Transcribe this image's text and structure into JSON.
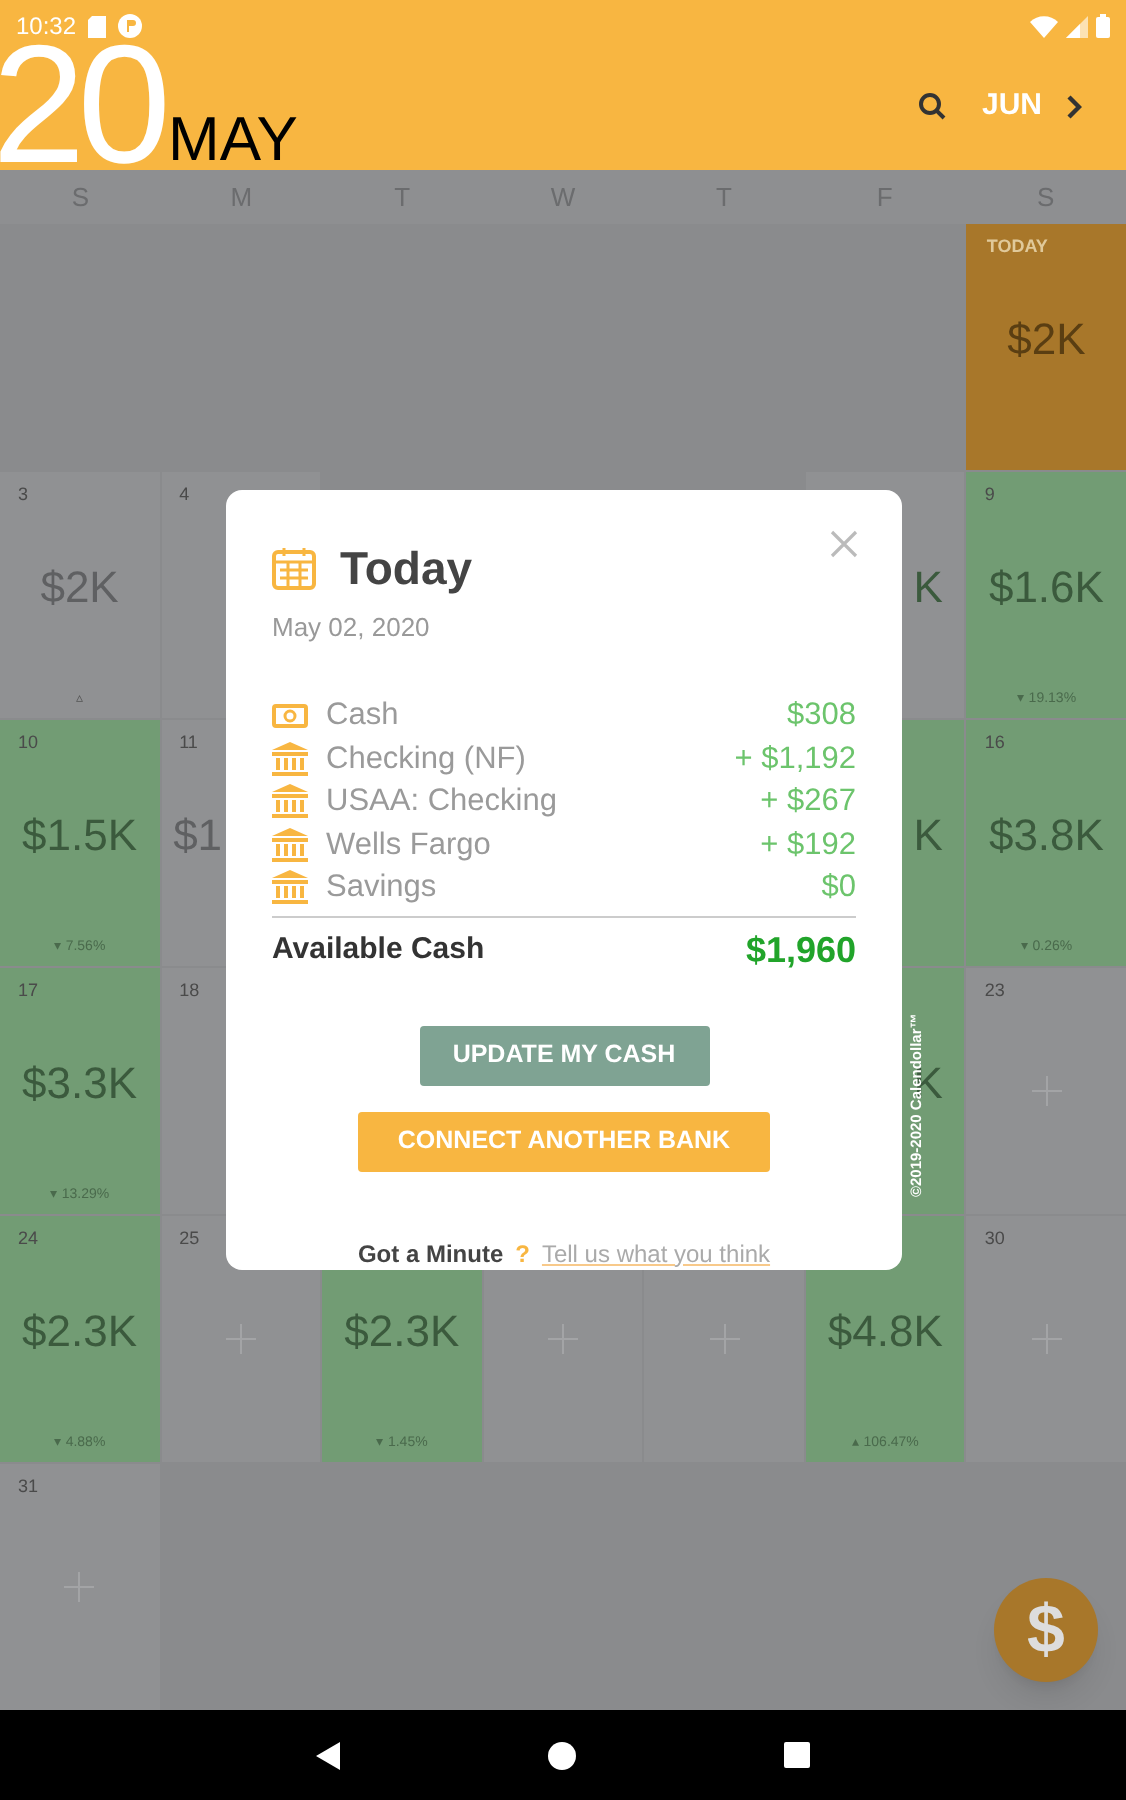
{
  "status_bar": {
    "time": "10:32"
  },
  "header": {
    "day": "20",
    "month": "MAY",
    "next_month": "JUN"
  },
  "weekdays": [
    "S",
    "M",
    "T",
    "W",
    "T",
    "F",
    "S"
  ],
  "cells": [
    {
      "kind": "blank"
    },
    {
      "kind": "blank"
    },
    {
      "kind": "blank"
    },
    {
      "kind": "blank"
    },
    {
      "kind": "blank"
    },
    {
      "kind": "blank"
    },
    {
      "kind": "today",
      "color": "#a8772a",
      "label": "TODAY",
      "amount": "$2K"
    },
    {
      "kind": "amount",
      "color": "#909193",
      "day": "3",
      "amount": "$2K",
      "change": "▵"
    },
    {
      "kind": "day_only",
      "day": "4"
    },
    {
      "kind": "blank"
    },
    {
      "kind": "blank"
    },
    {
      "kind": "blank"
    },
    {
      "kind": "right_part",
      "color": "#909193",
      "amount": "K"
    },
    {
      "kind": "amount",
      "color": "#729c74",
      "day": "9",
      "amount": "$1.6K",
      "change": "▾ 19.13%"
    },
    {
      "kind": "amount",
      "color": "#729c74",
      "day": "10",
      "amount": "$1.5K",
      "change": "▾ 7.56%"
    },
    {
      "kind": "left_part",
      "color": "#909193",
      "day": "11",
      "amount": "$1"
    },
    {
      "kind": "blank"
    },
    {
      "kind": "blank"
    },
    {
      "kind": "blank"
    },
    {
      "kind": "right_part",
      "color": "#729c74",
      "amount": "K"
    },
    {
      "kind": "amount",
      "color": "#729c74",
      "day": "16",
      "amount": "$3.8K",
      "change": "▾ 0.26%"
    },
    {
      "kind": "amount",
      "color": "#729c74",
      "day": "17",
      "amount": "$3.3K",
      "change": "▾ 13.29%"
    },
    {
      "kind": "day_only",
      "day": "18"
    },
    {
      "kind": "blank"
    },
    {
      "kind": "blank"
    },
    {
      "kind": "blank"
    },
    {
      "kind": "right_part",
      "color": "#729c74",
      "amount": "K"
    },
    {
      "kind": "add",
      "color": "#909193",
      "day": "23"
    },
    {
      "kind": "amount",
      "color": "#729c74",
      "day": "24",
      "amount": "$2.3K",
      "change": "▾ 4.88%"
    },
    {
      "kind": "add",
      "color": "#909193",
      "day": "25"
    },
    {
      "kind": "amount",
      "color": "#729c74",
      "amount": "$2.3K",
      "change": "▾ 1.45%"
    },
    {
      "kind": "add",
      "color": "#909193"
    },
    {
      "kind": "add",
      "color": "#909193"
    },
    {
      "kind": "amount",
      "color": "#729c74",
      "amount": "$4.8K",
      "change": "▴ 106.47%"
    },
    {
      "kind": "add",
      "color": "#909193",
      "day": "30"
    },
    {
      "kind": "add",
      "color": "#909193",
      "day": "31"
    },
    {
      "kind": "blank"
    },
    {
      "kind": "blank"
    },
    {
      "kind": "blank"
    },
    {
      "kind": "blank"
    },
    {
      "kind": "blank"
    },
    {
      "kind": "blank"
    }
  ],
  "copyright": "©2019-2020 Calendollar™",
  "dialog": {
    "title": "Today",
    "date": "May 02, 2020",
    "accounts": [
      {
        "kind": "cash",
        "name": "Cash",
        "amount": "$308"
      },
      {
        "kind": "bank",
        "name": "Checking (NF)",
        "amount": "+ $1,192"
      },
      {
        "kind": "bank",
        "name": "USAA: Checking",
        "amount": "+ $267"
      },
      {
        "kind": "bank",
        "name": "Wells Fargo",
        "amount": "+ $192"
      },
      {
        "kind": "bank",
        "name": "Savings",
        "amount": "$0"
      }
    ],
    "total_label": "Available Cash",
    "total": "$1,960",
    "buttons": [
      {
        "kind": "secondary",
        "label": "UPDATE MY CASH"
      },
      {
        "kind": "primary",
        "label": "CONNECT ANOTHER BANK"
      }
    ],
    "feedback_prompt": "Got a Minute",
    "feedback_mark": "?",
    "feedback_link": "Tell us what you think"
  },
  "fab": {
    "label": "$"
  }
}
